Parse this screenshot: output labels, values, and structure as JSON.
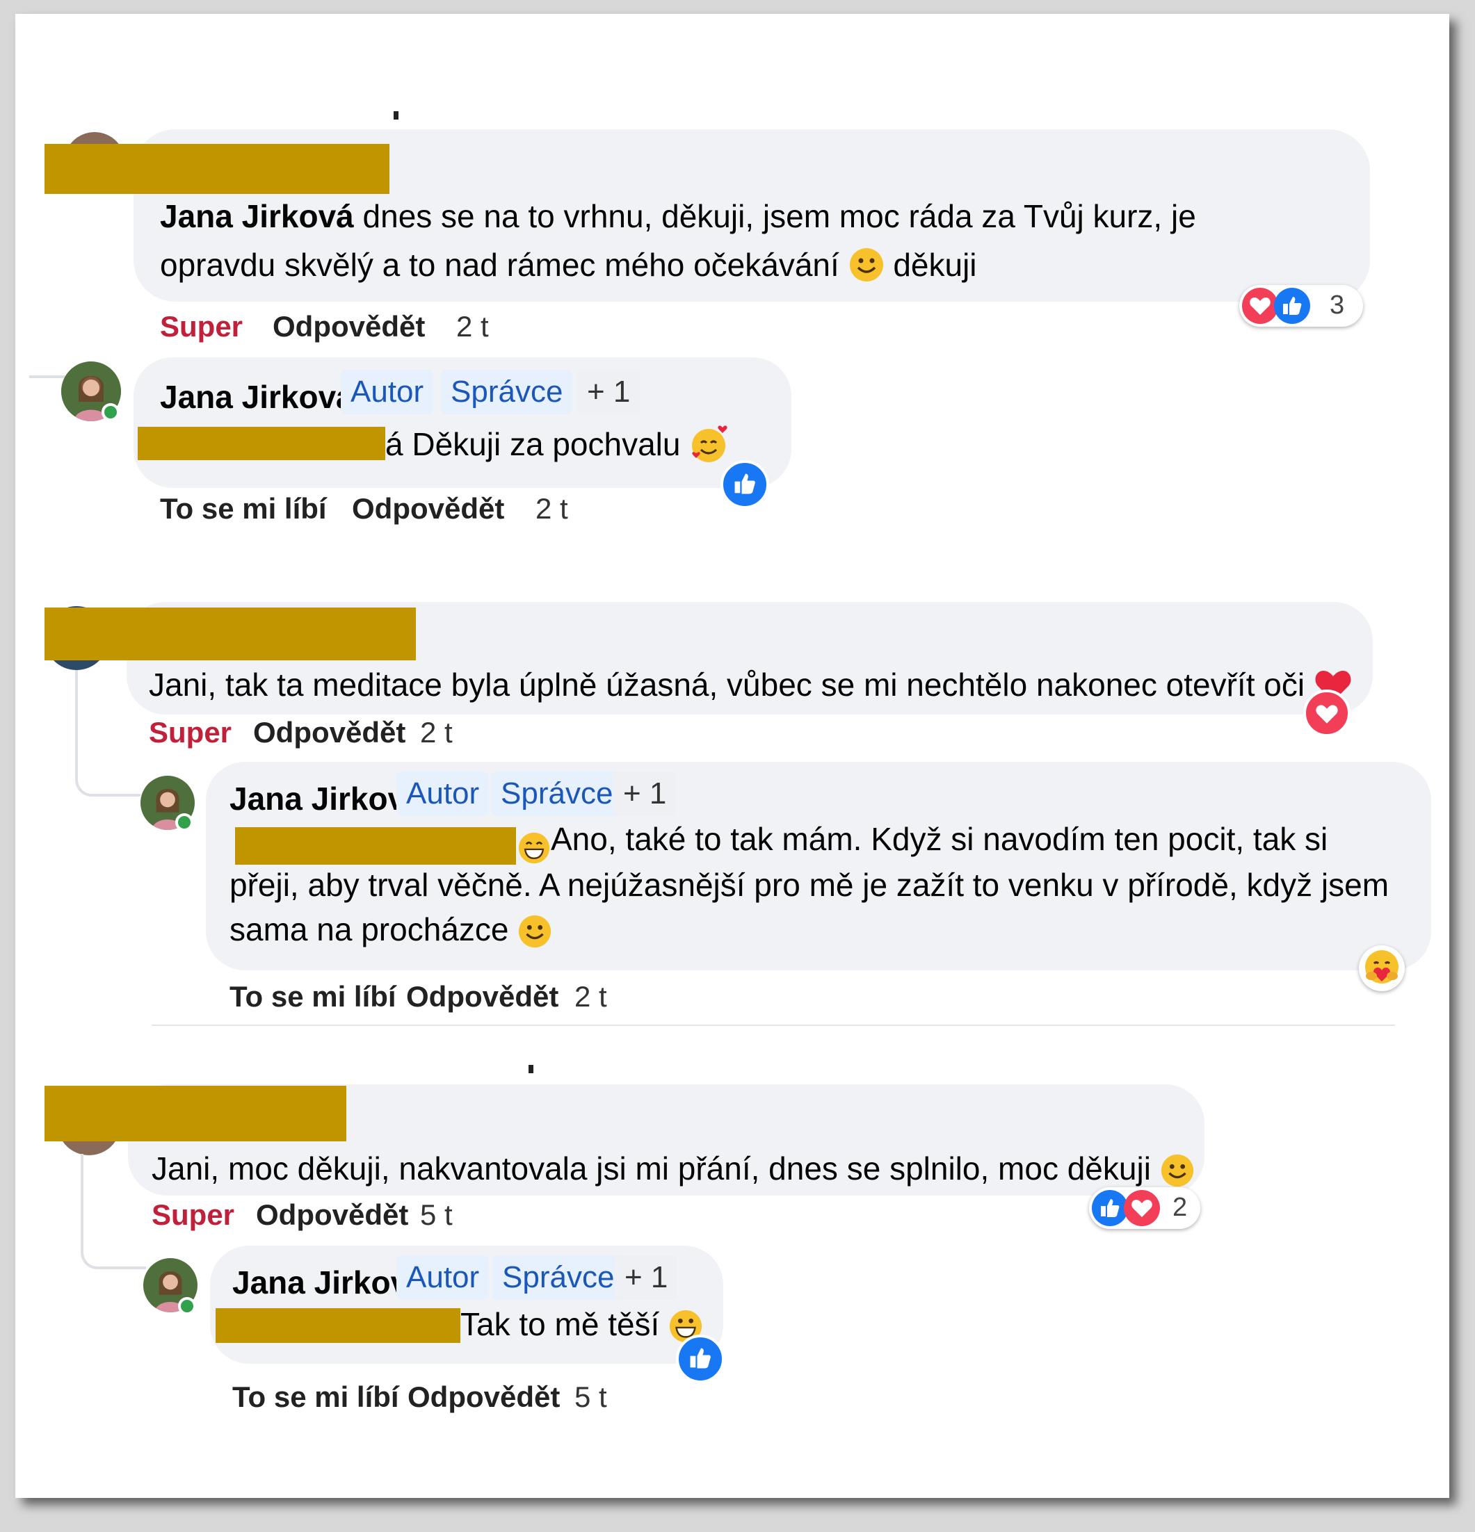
{
  "badges": {
    "author": "Autor",
    "admin": "Správce",
    "more": "+ 1"
  },
  "colors": {
    "redaction": "#c09500",
    "super": "#c0213a",
    "like": "#1877f2",
    "love": "#f33e58",
    "badge_text": "#1a57b8"
  },
  "comments": [
    {
      "mention": "Jana Jirková",
      "text_line1": "dnes se na to vrhnu, děkuji, jsem moc ráda za Tvůj kurz, je",
      "text_line2": "opravdu skvělý a to nad rámec mého očekávání",
      "text_end": "děkuji",
      "reaction_label": "Super",
      "reply_label": "Odpovědět",
      "time": "2 t",
      "reaction_count": "3",
      "reaction_icons": [
        "love-icon",
        "like-icon"
      ]
    },
    {
      "text": "Jani, tak ta meditace byla úplně úžasná, vůbec se mi nechtělo nakonec otevřít oči",
      "reaction_label": "Super",
      "reply_label": "Odpovědět",
      "time": "2 t",
      "reaction_icons": [
        "love-icon"
      ]
    },
    {
      "text": "Jani, moc děkuji, nakvantovala jsi mi přání, dnes se splnilo, moc děkuji",
      "reaction_label": "Super",
      "reply_label": "Odpovědět",
      "time": "5 t",
      "reaction_count": "2",
      "reaction_icons": [
        "like-icon",
        "love-icon"
      ]
    }
  ],
  "replies": [
    {
      "author": "Jana Jirková",
      "text": "á Děkuji za pochvalu",
      "like_label": "To se mi líbí",
      "reply_label": "Odpovědět",
      "time": "2 t",
      "reaction_icons": [
        "like-icon"
      ]
    },
    {
      "author": "Jana Jirková",
      "text_line1": "Ano, také to tak mám. Když si navodím ten pocit, tak si",
      "text_line2": "přeji, aby trval věčně. A nejúžasnější pro mě je zažít to venku v přírodě, když jsem",
      "text_line3": "sama na procházce",
      "like_label": "To se mi líbí",
      "reply_label": "Odpovědět",
      "time": "2 t",
      "reaction_icons": [
        "care-icon"
      ]
    },
    {
      "author": "Jana Jirková",
      "text": "Tak to mě těší",
      "like_label": "To se mi líbí",
      "reply_label": "Odpovědět",
      "time": "5 t",
      "reaction_icons": [
        "like-icon"
      ]
    }
  ]
}
